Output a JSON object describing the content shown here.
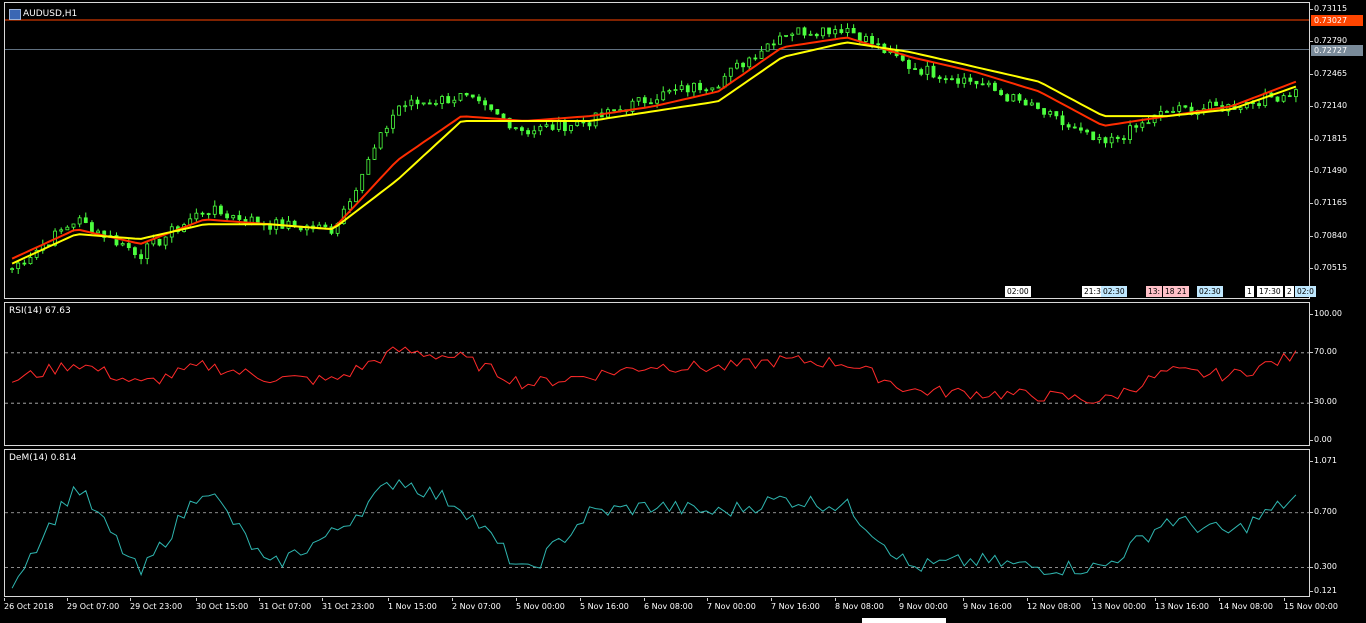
{
  "window": {
    "symbol_label": "AUDUSD,H1"
  },
  "main": {
    "ylim": [
      0.702,
      0.732
    ],
    "price_ticks": [
      "0.73115",
      "0.72790",
      "0.72465",
      "0.72140",
      "0.71815",
      "0.71490",
      "0.71165",
      "0.70840",
      "0.70515"
    ],
    "high_line": {
      "label": "0.73027",
      "value": 0.73027,
      "color": "#ff4500"
    },
    "bid_line": {
      "label": "0.72727",
      "value": 0.72727,
      "color": "#607080"
    },
    "colors": {
      "candle": "#4cff3f",
      "ma_fast": "#ff2d00",
      "ma_slow": "#ffff00"
    },
    "session_markers": [
      {
        "text": "02:00",
        "style": "white"
      },
      {
        "text": "21:3",
        "style": "white"
      },
      {
        "text": "02:30",
        "style": "cyan"
      },
      {
        "text": "13:",
        "style": "pink"
      },
      {
        "text": "18",
        "style": "pink"
      },
      {
        "text": "21",
        "style": "pink"
      },
      {
        "text": "02:30",
        "style": "cyan"
      },
      {
        "text": "1",
        "style": "white"
      },
      {
        "text": "17:30",
        "style": "white"
      },
      {
        "text": "2",
        "style": "white"
      },
      {
        "text": "02:0",
        "style": "cyan"
      }
    ]
  },
  "rsi": {
    "label": "RSI(14) 67.63",
    "levels": [
      "100.00",
      "70.00",
      "30.00",
      "0.00"
    ],
    "color": "#ff2a2a"
  },
  "dem": {
    "label": "DeM(14) 0.814",
    "levels": [
      "1.071",
      "0.700",
      "0.300",
      "0.121"
    ],
    "color": "#2fb6b0"
  },
  "time_labels": [
    "26 Oct 2018",
    "29 Oct 07:00",
    "29 Oct 23:00",
    "30 Oct 15:00",
    "31 Oct 07:00",
    "31 Oct 23:00",
    "1 Nov 15:00",
    "2 Nov 07:00",
    "5 Nov 00:00",
    "5 Nov 16:00",
    "6 Nov 08:00",
    "7 Nov 00:00",
    "7 Nov 16:00",
    "8 Nov 08:00",
    "9 Nov 00:00",
    "9 Nov 16:00",
    "12 Nov 08:00",
    "13 Nov 00:00",
    "13 Nov 16:00",
    "14 Nov 08:00",
    "15 Nov 00:00"
  ],
  "chart_data": {
    "type": "line",
    "title": "AUDUSD,H1",
    "x": [
      "26 Oct 2018",
      "29 Oct 07:00",
      "29 Oct 23:00",
      "30 Oct 15:00",
      "31 Oct 07:00",
      "31 Oct 23:00",
      "1 Nov 15:00",
      "2 Nov 07:00",
      "5 Nov 00:00",
      "5 Nov 16:00",
      "6 Nov 08:00",
      "7 Nov 00:00",
      "7 Nov 16:00",
      "8 Nov 08:00",
      "9 Nov 00:00",
      "9 Nov 16:00",
      "12 Nov 08:00",
      "13 Nov 00:00",
      "13 Nov 16:00",
      "14 Nov 08:00",
      "15 Nov 00:00"
    ],
    "series": [
      {
        "values": [
          0.705,
          0.71,
          0.7065,
          0.711,
          0.7095,
          0.709,
          0.7215,
          0.7225,
          0.719,
          0.72,
          0.7225,
          0.724,
          0.729,
          0.7295,
          0.7255,
          0.724,
          0.721,
          0.7175,
          0.721,
          0.7215,
          0.723
        ]
      },
      {
        "values": [
          0.706,
          0.709,
          0.7075,
          0.71,
          0.7095,
          0.709,
          0.716,
          0.7205,
          0.72,
          0.7205,
          0.7215,
          0.723,
          0.7275,
          0.7285,
          0.7265,
          0.725,
          0.723,
          0.7195,
          0.7205,
          0.7215,
          0.724
        ]
      },
      {
        "values": [
          0.7055,
          0.7085,
          0.708,
          0.7095,
          0.7095,
          0.709,
          0.714,
          0.72,
          0.72,
          0.72,
          0.721,
          0.722,
          0.7265,
          0.728,
          0.727,
          0.7255,
          0.724,
          0.7205,
          0.7205,
          0.7212,
          0.7235
        ]
      }
    ],
    "ylim": [
      0.702,
      0.732
    ],
    "rsi_values": [
      48,
      62,
      45,
      60,
      50,
      48,
      72,
      66,
      45,
      52,
      60,
      58,
      64,
      62,
      40,
      38,
      36,
      32,
      55,
      52,
      67.63
    ],
    "rsi_ylim": [
      0,
      100
    ],
    "dem_values": [
      0.2,
      0.9,
      0.25,
      0.9,
      0.3,
      0.55,
      0.95,
      0.75,
      0.25,
      0.7,
      0.75,
      0.7,
      0.8,
      0.75,
      0.3,
      0.35,
      0.3,
      0.3,
      0.65,
      0.55,
      0.814
    ],
    "dem_ylim": [
      0.121,
      1.071
    ],
    "grid": false
  }
}
